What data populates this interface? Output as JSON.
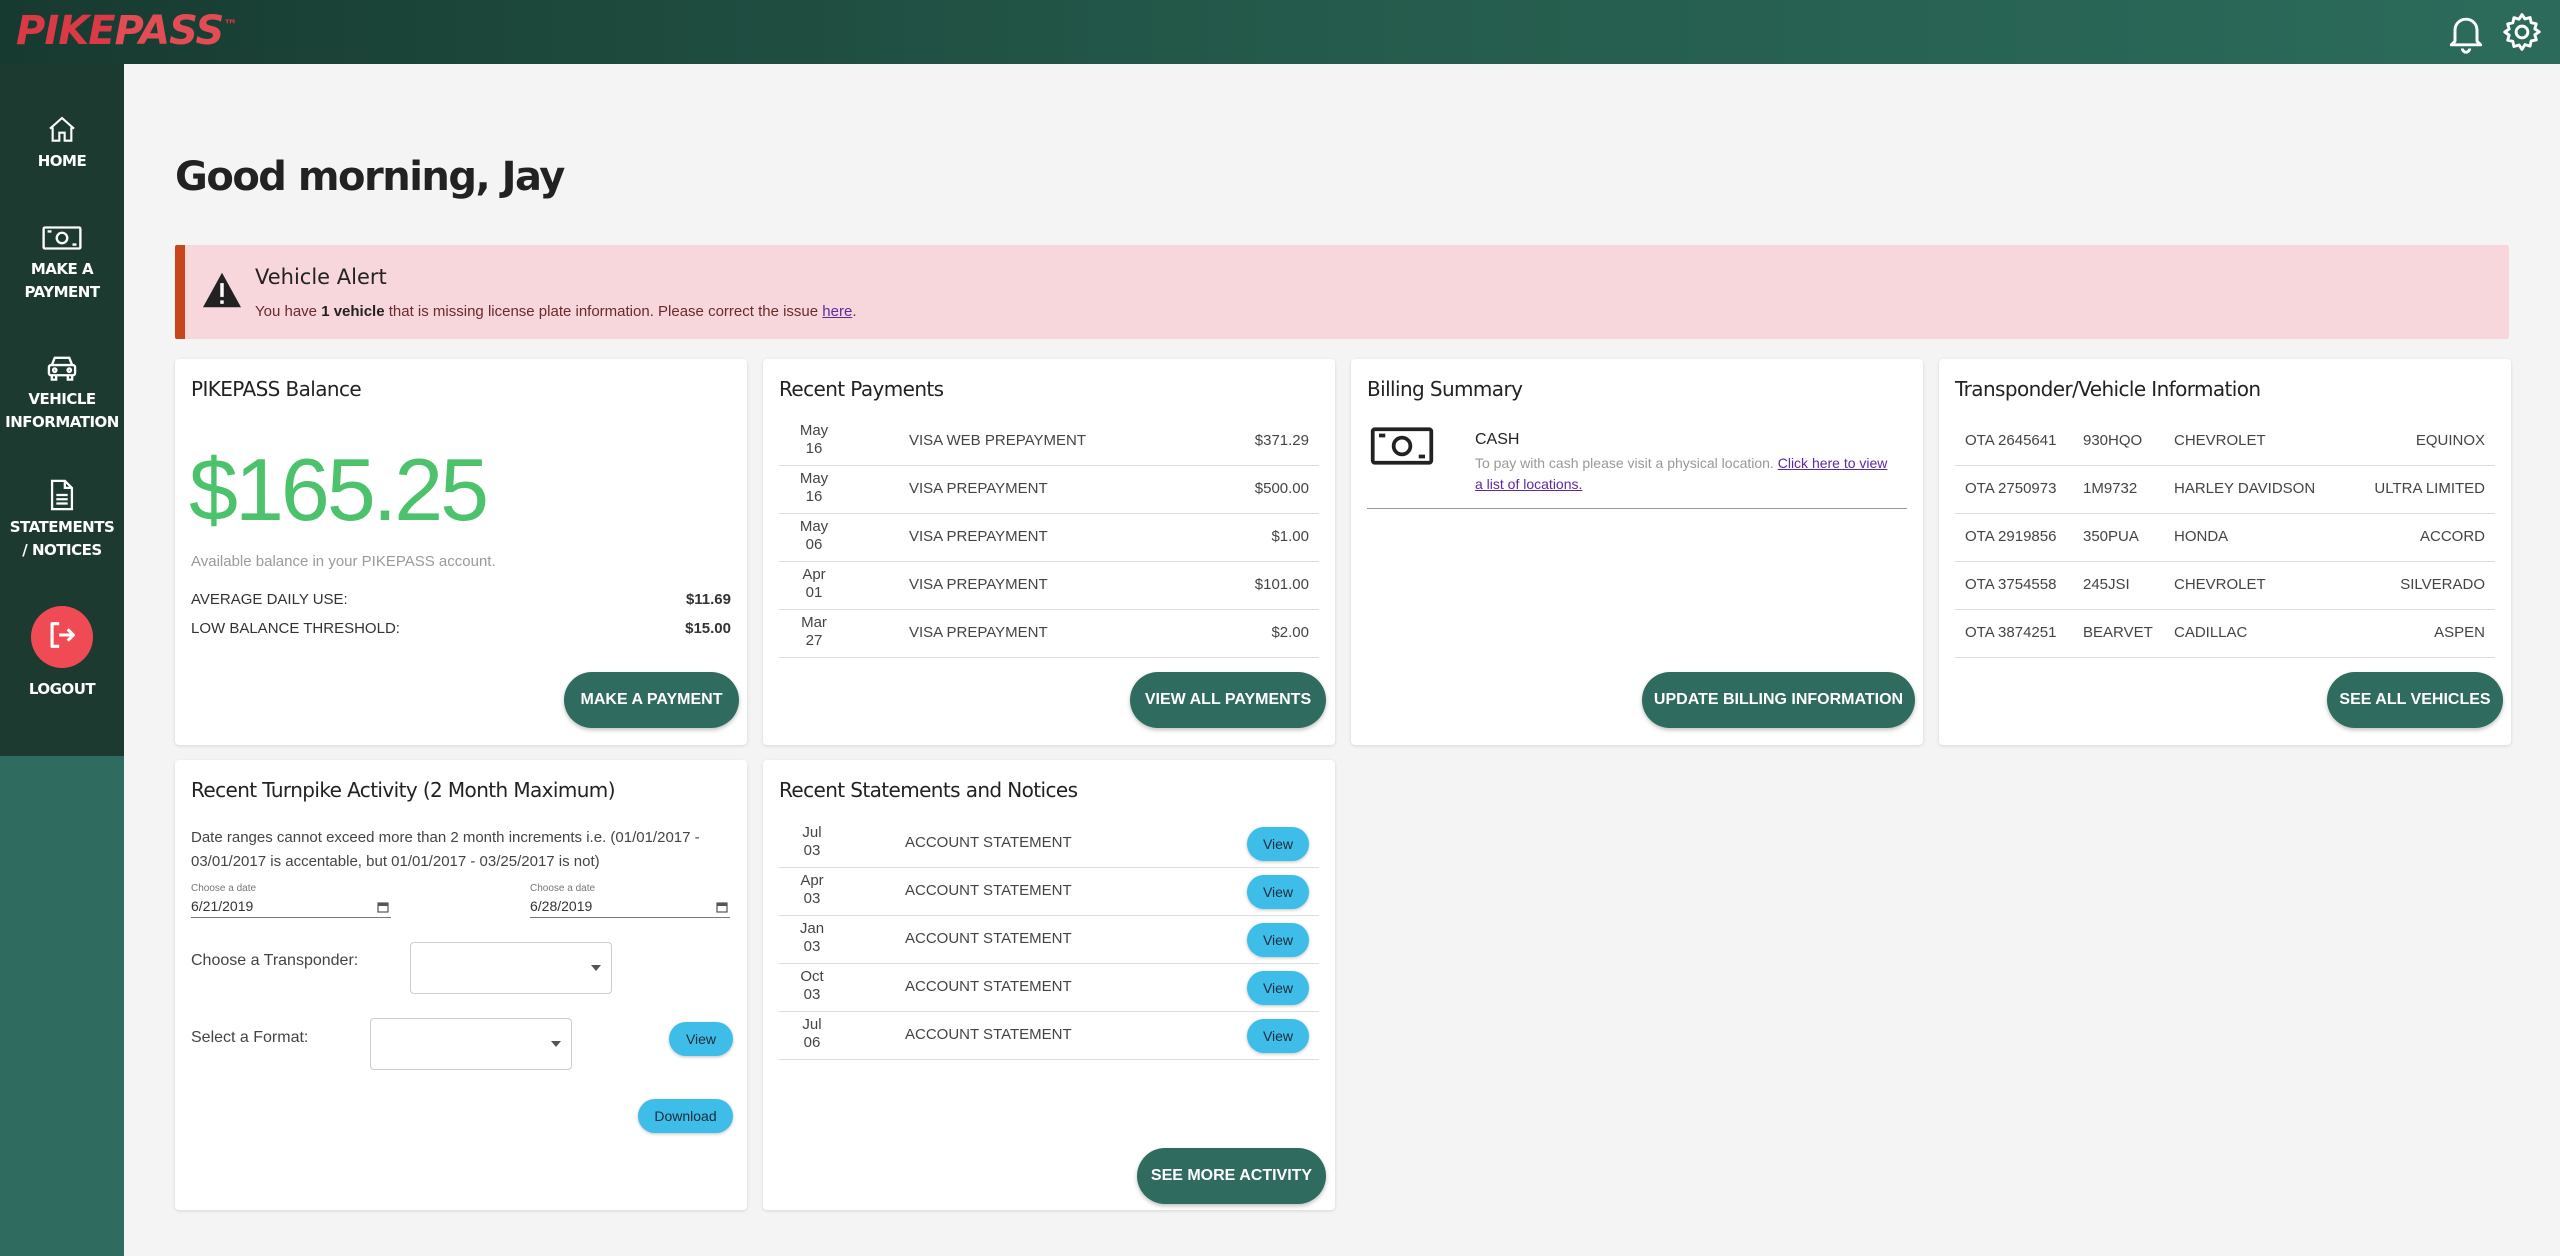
{
  "app": {
    "logo_part1": "PIKE",
    "logo_part2": "PASS",
    "logo_tm": "™",
    "colors": {
      "brand_green": "#2f6b5e",
      "sidebar": "#1d3a31",
      "logo_red": "#d93a45",
      "balance_green": "#4cc26d",
      "alert_bg": "#f7d7dc",
      "alert_border": "#c8461c",
      "chip_blue": "#3dbde8"
    }
  },
  "header": {
    "icons": [
      "bell-icon",
      "gear-icon"
    ]
  },
  "sidebar": {
    "items": [
      {
        "line1": "HOME",
        "line2": "",
        "icon": "home-icon"
      },
      {
        "line1": "MAKE A",
        "line2": "PAYMENT",
        "icon": "cash-icon"
      },
      {
        "line1": "VEHICLE",
        "line2": "INFORMATION",
        "icon": "car-icon"
      },
      {
        "line1": "STATEMENTS",
        "line2": "/ NOTICES",
        "icon": "document-icon"
      }
    ],
    "logout": {
      "label": "LOGOUT",
      "icon": "logout-icon"
    }
  },
  "greeting": "Good morning, Jay",
  "alert": {
    "title": "Vehicle Alert",
    "text_before": "You have ",
    "bold": "1 vehicle",
    "text_after": " that is missing license plate information. Please correct the issue ",
    "link": "here",
    "end": "."
  },
  "balance_card": {
    "title": "PIKEPASS Balance",
    "amount": "$165.25",
    "note": "Available balance in your PIKEPASS account.",
    "avg_label": "AVERAGE DAILY USE:",
    "avg_value": "$11.69",
    "low_label": "LOW BALANCE THRESHOLD:",
    "low_value": "$15.00",
    "button": "MAKE A PAYMENT"
  },
  "payments_card": {
    "title": "Recent Payments",
    "rows": [
      {
        "month": "May",
        "day": "16",
        "desc": "VISA WEB PREPAYMENT",
        "amount": "$371.29"
      },
      {
        "month": "May",
        "day": "16",
        "desc": "VISA PREPAYMENT",
        "amount": "$500.00"
      },
      {
        "month": "May",
        "day": "06",
        "desc": "VISA PREPAYMENT",
        "amount": "$1.00"
      },
      {
        "month": "Apr",
        "day": "01",
        "desc": "VISA PREPAYMENT",
        "amount": "$101.00"
      },
      {
        "month": "Mar",
        "day": "27",
        "desc": "VISA PREPAYMENT",
        "amount": "$2.00"
      }
    ],
    "button": "VIEW ALL PAYMENTS"
  },
  "billing_card": {
    "title": "Billing Summary",
    "method": "CASH",
    "text": "To pay with cash please visit a physical location. ",
    "link_line1": "Click here to view",
    "link_line2": "a list of locations.",
    "button": "UPDATE BILLING INFORMATION"
  },
  "vehicles_card": {
    "title": "Transponder/Vehicle Information",
    "rows": [
      {
        "tag": "OTA 2645641",
        "plate": "930HQO",
        "make": "CHEVROLET",
        "model": "EQUINOX"
      },
      {
        "tag": "OTA 2750973",
        "plate": "1M9732",
        "make": "HARLEY DAVIDSON",
        "model": "ULTRA LIMITED"
      },
      {
        "tag": "OTA 2919856",
        "plate": "350PUA",
        "make": "HONDA",
        "model": "ACCORD"
      },
      {
        "tag": "OTA 3754558",
        "plate": "245JSI",
        "make": "CHEVROLET",
        "model": "SILVERADO"
      },
      {
        "tag": "OTA 3874251",
        "plate": "BEARVET",
        "make": "CADILLAC",
        "model": "ASPEN"
      }
    ],
    "button": "SEE ALL VEHICLES"
  },
  "activity_card": {
    "title": "Recent Turnpike Activity (2 Month Maximum)",
    "note_line1": "Date ranges cannot exceed more than 2 month increments i.e. (01/01/2017 -",
    "note_line2": "03/01/2017 is accentable, but 01/01/2017 - 03/25/2017 is not)",
    "date1_label": "Choose a date",
    "date1_value": "6/21/2019",
    "date2_label": "Choose a date",
    "date2_value": "6/28/2019",
    "transponder_label": "Choose a Transponder:",
    "format_label": "Select a Format:",
    "view_button": "View",
    "download_button": "Download"
  },
  "statements_card": {
    "title": "Recent Statements and Notices",
    "rows": [
      {
        "month": "Jul",
        "day": "03",
        "desc": "ACCOUNT STATEMENT",
        "button": "View"
      },
      {
        "month": "Apr",
        "day": "03",
        "desc": "ACCOUNT STATEMENT",
        "button": "View"
      },
      {
        "month": "Jan",
        "day": "03",
        "desc": "ACCOUNT STATEMENT",
        "button": "View"
      },
      {
        "month": "Oct",
        "day": "03",
        "desc": "ACCOUNT STATEMENT",
        "button": "View"
      },
      {
        "month": "Jul",
        "day": "06",
        "desc": "ACCOUNT STATEMENT",
        "button": "View"
      }
    ],
    "button": "SEE MORE ACTIVITY"
  }
}
